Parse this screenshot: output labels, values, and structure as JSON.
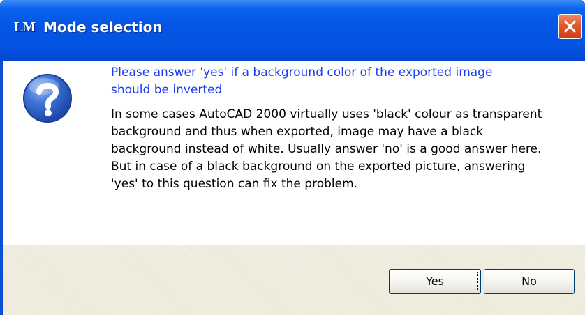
{
  "window": {
    "app_icon_text": "LM",
    "title": "Mode selection",
    "close_icon": "close-x-icon"
  },
  "dialog": {
    "icon": "question-icon",
    "prompt": "Please answer 'yes' if a background color of the exported image should be inverted",
    "description": "In some cases AutoCAD 2000 virtually uses 'black' colour as transparent background and thus when exported, image may have a black background instead of white. Usually answer 'no' is a good answer here. But in case of a black background on the exported picture, answering 'yes' to this question can fix the problem."
  },
  "buttons": {
    "yes_label": "Yes",
    "no_label": "No"
  },
  "colors": {
    "titlebar": "#0353e0",
    "prompt_text": "#1a3cf0",
    "close_button": "#e25a2c",
    "footer": "#ece9d8"
  }
}
